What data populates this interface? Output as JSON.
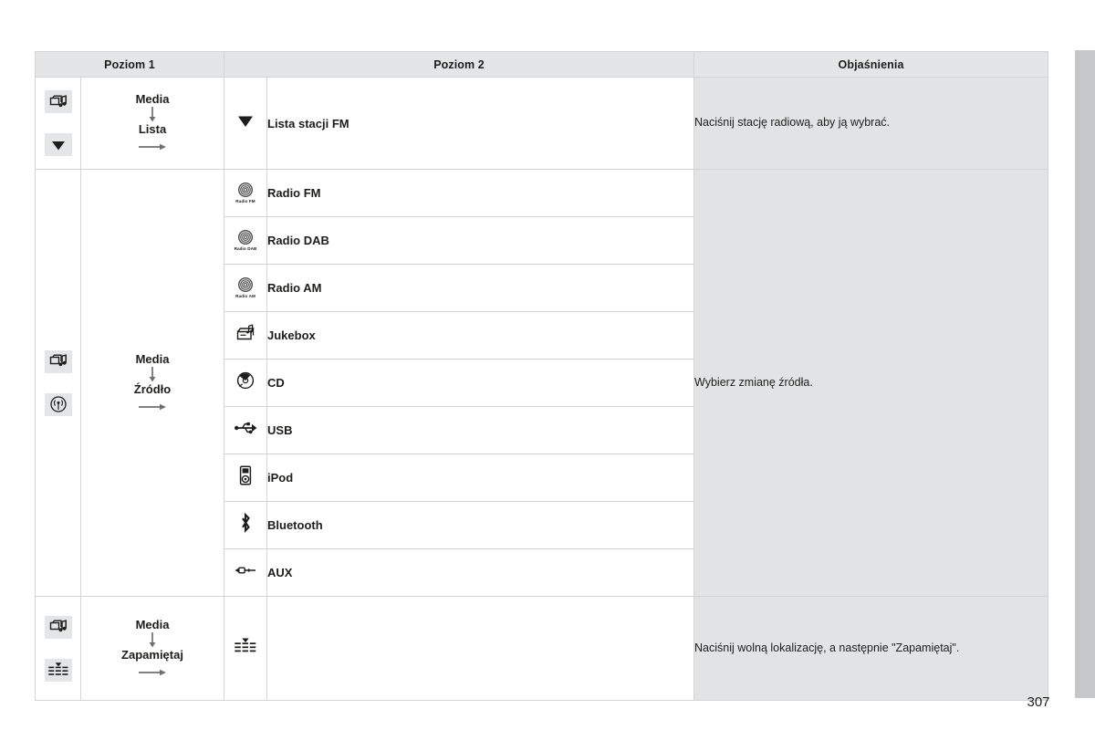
{
  "page": {
    "number": "307",
    "accent_gray": "#c6c7c9",
    "header_bg": "#e4e5e7",
    "explanation_bg": "#e2e3e5",
    "border_color": "#d3d4d6"
  },
  "table": {
    "headers": {
      "level1": "Poziom 1",
      "level2": "Poziom 2",
      "explanations": "Objaśnienia"
    },
    "rows": [
      {
        "id": "row-lista",
        "level1": {
          "icons": [
            "media-icon",
            "triangle-down-icon"
          ],
          "path": [
            "Media",
            "Lista"
          ]
        },
        "level2": [
          {
            "icon": "triangle-down-icon",
            "label": "Lista stacji FM"
          }
        ],
        "explanation": "Naciśnij stację radiową, aby ją wybrać."
      },
      {
        "id": "row-zrodlo",
        "level1": {
          "icons": [
            "media-icon",
            "source-antenna-icon"
          ],
          "path": [
            "Media",
            "Źródło"
          ]
        },
        "level2": [
          {
            "icon": "radio-fm-icon",
            "icon_caption": "Radio FM",
            "label": "Radio FM"
          },
          {
            "icon": "radio-dab-icon",
            "icon_caption": "Radio DAB",
            "label": "Radio DAB"
          },
          {
            "icon": "radio-am-icon",
            "icon_caption": "Radio AM",
            "label": "Radio AM"
          },
          {
            "icon": "jukebox-icon",
            "label": "Jukebox"
          },
          {
            "icon": "cd-disc-icon",
            "label": "CD"
          },
          {
            "icon": "usb-icon",
            "label": "USB"
          },
          {
            "icon": "ipod-icon",
            "label": "iPod"
          },
          {
            "icon": "bluetooth-icon",
            "label": "Bluetooth"
          },
          {
            "icon": "aux-jack-icon",
            "label": "AUX"
          }
        ],
        "explanation": "Wybierz zmianę źródła."
      },
      {
        "id": "row-zapamietaj",
        "level1": {
          "icons": [
            "media-icon",
            "memorize-grid-icon"
          ],
          "path": [
            "Media",
            "Zapamiętaj"
          ]
        },
        "level2": [
          {
            "icon": "memorize-grid-icon",
            "label": ""
          }
        ],
        "explanation": "Naciśnij wolną lokalizację, a następnie \"Zapamiętaj\"."
      }
    ]
  }
}
